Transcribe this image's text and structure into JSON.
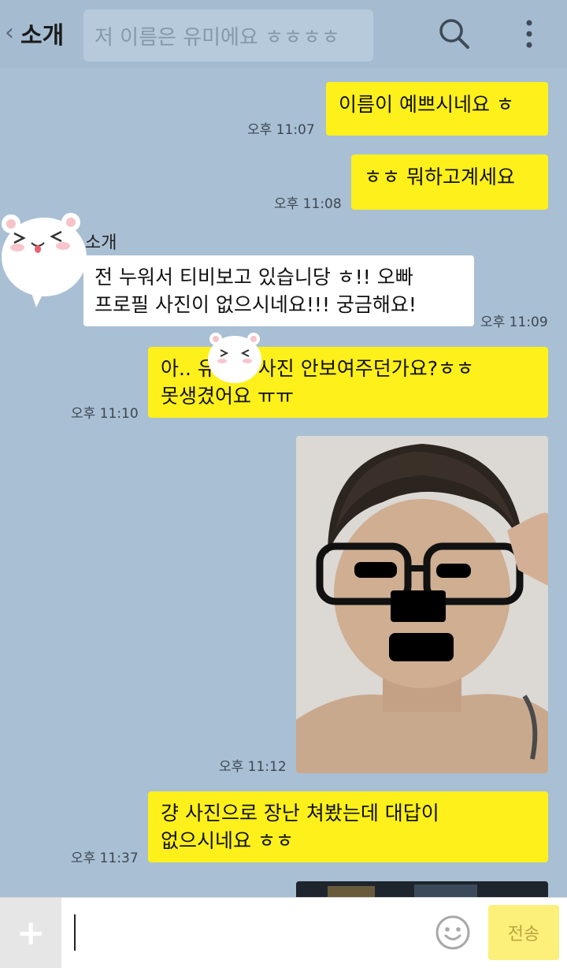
{
  "header": {
    "back_icon": "chevron-left-icon",
    "title": "소개",
    "pinned_notice": "저 이름은 유미에요 ㅎㅎㅎㅎ",
    "search_icon": "search-icon",
    "menu_icon": "more-vertical-icon"
  },
  "chat": {
    "sender_name": "소개",
    "messages": [
      {
        "from": "me",
        "text": "이름이 예쁘시네요 ㅎ",
        "time": "오후 11:07"
      },
      {
        "from": "me",
        "text": "ㅎㅎ 뭐하고계세요",
        "time": "오후 11:08"
      },
      {
        "from": "them",
        "lines": [
          "전 누워서 티비보고 있습니당 ㅎ!!  오빠",
          "프로필 사진이 없으시네요!!! 궁금해요!"
        ],
        "time": "오후 11:09"
      },
      {
        "from": "me",
        "lines": [
          "아.. 유미가 사진 안보여주던가요?ㅎㅎ",
          "못생겼어요 ㅠㅠ"
        ],
        "time": "오후 11:10"
      },
      {
        "from": "me",
        "type": "photo",
        "time": "오후 11:12"
      },
      {
        "from": "me",
        "lines": [
          "걍 사진으로 장난 쳐봤는데 대답이",
          "없으시네요 ㅎㅎ"
        ],
        "time": "오후 11:37"
      }
    ]
  },
  "input_bar": {
    "plus_icon": "plus-icon",
    "text_value": "",
    "emoji_icon": "smiley-icon",
    "send_label": "전송"
  },
  "colors": {
    "background": "#a9bfd4",
    "my_bubble": "#fef01b",
    "their_bubble": "#ffffff",
    "send_button": "#fcef7a"
  }
}
